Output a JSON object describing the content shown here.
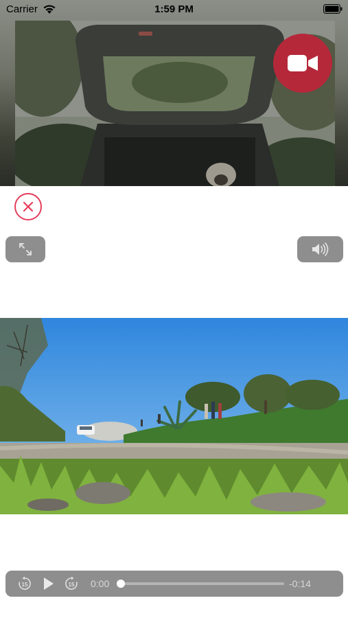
{
  "status_bar": {
    "carrier": "Carrier",
    "time": "1:59 PM"
  },
  "top_video": {
    "record_icon": "video-camera-icon",
    "record_color": "#b5283a"
  },
  "controls": {
    "close_icon": "close-x-icon",
    "close_color": "#e63c5a",
    "expand_icon": "expand-arrows-icon",
    "volume_icon": "speaker-volume-icon",
    "button_color": "#8e8e8e"
  },
  "player": {
    "rewind_icon": "rewind-15-icon",
    "rewind_seconds": "15",
    "play_icon": "play-icon",
    "forward_icon": "forward-15-icon",
    "forward_seconds": "15",
    "elapsed": "0:00",
    "remaining": "-0:14",
    "progress": 0.0
  }
}
